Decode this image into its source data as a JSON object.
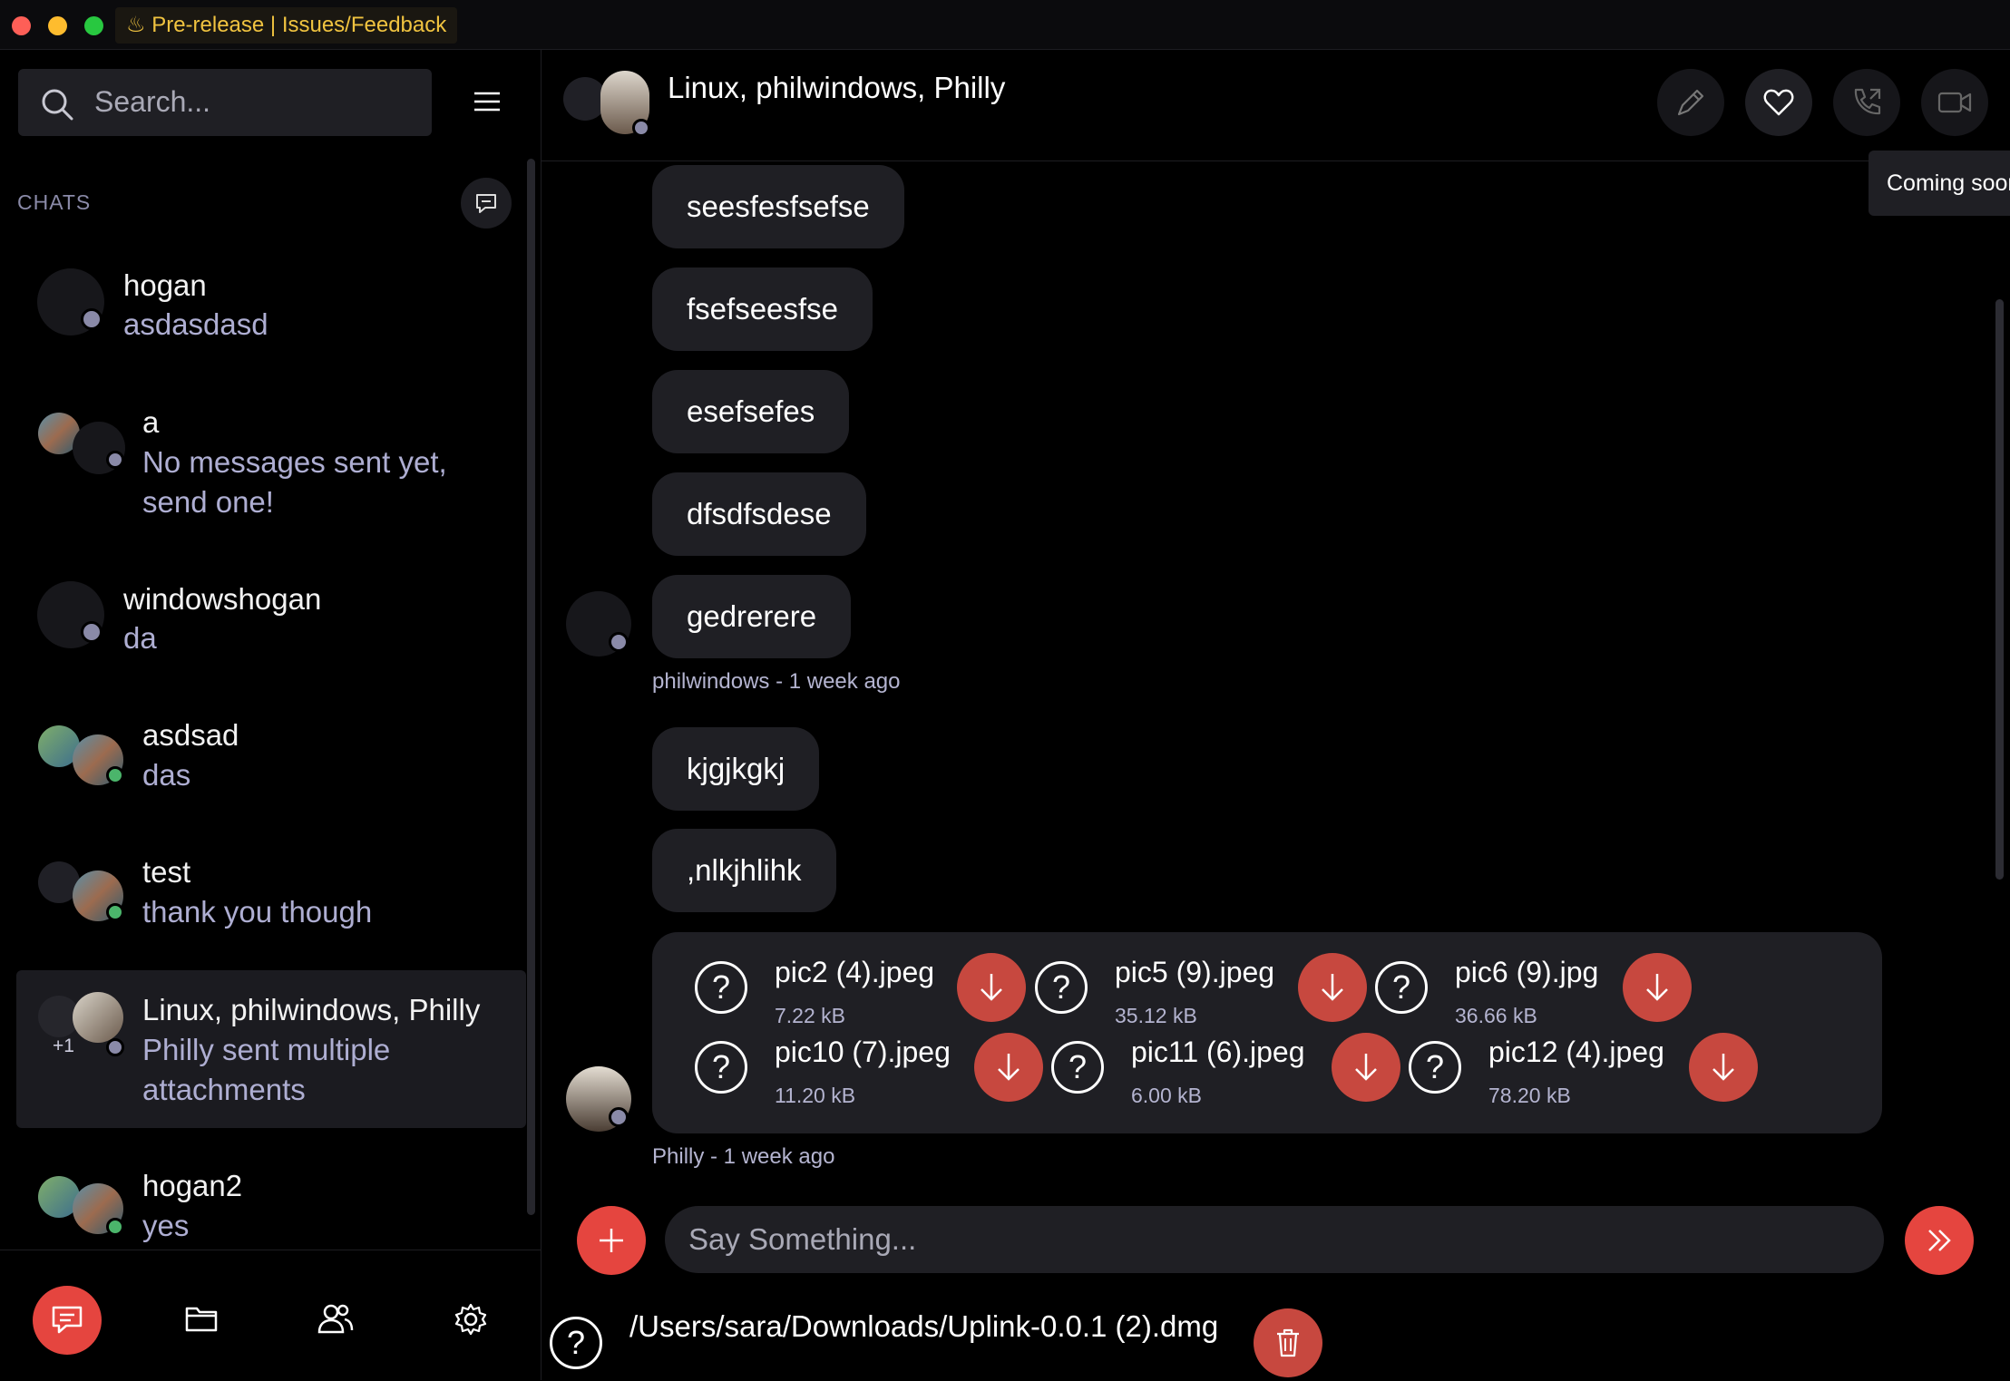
{
  "titlebar": {
    "prerelease_label": "Pre-release | Issues/Feedback"
  },
  "sidebar": {
    "search_placeholder": "Search...",
    "chats_label": "CHATS",
    "chats": [
      {
        "name": "hogan",
        "message": "asdasdasd"
      },
      {
        "name": "a",
        "message": "No messages sent yet, send one!"
      },
      {
        "name": "windowshogan",
        "message": "da"
      },
      {
        "name": "asdsad",
        "message": "das"
      },
      {
        "name": "test",
        "message": "thank you though"
      },
      {
        "name": "Linux, philwindows, Philly",
        "message": "Philly sent multiple attachments",
        "extra_count": "+1"
      },
      {
        "name": "hogan2",
        "message": "yes"
      }
    ]
  },
  "conversation": {
    "title": "Linux, philwindows, Philly",
    "tooltip": "Coming soon",
    "messages_group1": [
      "seesfesfsefse",
      "fsefseesfse",
      "esefsefes",
      "dfsdfsdese",
      "gedrerere"
    ],
    "meta1": "philwindows - 1 week ago",
    "messages_group2": [
      "kjgjkgkj",
      ",nlkjhlihk"
    ],
    "attachments": [
      {
        "name": "pic2 (4).jpeg",
        "size": "7.22 kB"
      },
      {
        "name": "pic5 (9).jpeg",
        "size": "35.12 kB"
      },
      {
        "name": "pic6 (9).jpg",
        "size": "36.66 kB"
      },
      {
        "name": "pic10 (7).jpeg",
        "size": "11.20 kB"
      },
      {
        "name": "pic11 (6).jpeg",
        "size": "6.00 kB"
      },
      {
        "name": "pic12 (4).jpeg",
        "size": "78.20 kB"
      }
    ],
    "meta2": "Philly - 1 week ago",
    "composer_placeholder": "Say Something...",
    "pending_file": "/Users/sara/Downloads/Uplink-0.0.1 (2).dmg"
  },
  "colors": {
    "accent_red": "#e5453f",
    "download_red": "#c7483f",
    "prerelease_yellow": "#f0c340",
    "online_green": "#4bb56b"
  }
}
